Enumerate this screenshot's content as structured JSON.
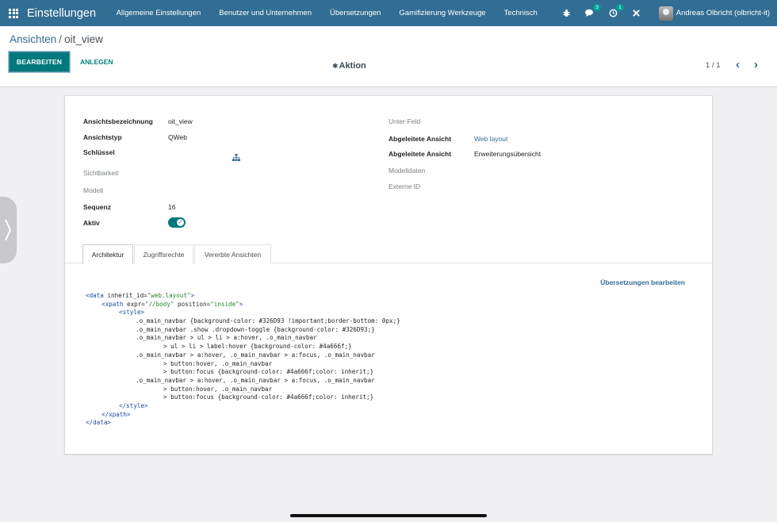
{
  "navbar": {
    "brand": "Einstellungen",
    "menu": [
      "Allgemeine Einstellungen",
      "Benutzer und Unternehmen",
      "Übersetzungen",
      "Gamifizierung Werkzeuge",
      "Technisch"
    ],
    "messages_badge": "3",
    "activity_badge": "1",
    "user_name": "Andreas Olbricht (olbricht-it)",
    "color": "#326D93"
  },
  "breadcrumb": {
    "parent": "Ansichten",
    "separator": "/",
    "current": "oit_view"
  },
  "toolbar": {
    "edit_label": "BEARBEITEN",
    "create_label": "ANLEGEN",
    "action_label": "Aktion"
  },
  "pager": {
    "value": "1 / 1"
  },
  "form": {
    "left": {
      "name_label": "Ansichtsbezeichnung",
      "name_value": "oit_view",
      "type_label": "Ansichtstyp",
      "type_value": "QWeb",
      "key_label": "Schlüssel",
      "visibility_label": "Sichtbarkeit",
      "model_label": "Modell",
      "sequence_label": "Sequenz",
      "sequence_value": "16",
      "active_label": "Aktiv",
      "active_value": true
    },
    "right": {
      "child_field_label": "Unter-Feld",
      "inherited_view_label": "Abgeleitete Ansicht",
      "inherited_view_value": "Web layout",
      "inherit_mode_label": "Abgeleitete Ansicht",
      "inherit_mode_value": "Erweiterungsübersicht",
      "model_data_label": "Modelldaten",
      "external_id_label": "Externe ID"
    }
  },
  "tabs": [
    "Architektur",
    "Zugriffsrechte",
    "Vererbte Ansichten"
  ],
  "translate_label": "Übersetzungen bearbeiten",
  "code": {
    "l1_open": "<data ",
    "l1_attr": "inherit_id=",
    "l1_val": "\"web.layout\"",
    "l1_close": ">",
    "l2_open": "<xpath ",
    "l2_attr1": "expr=",
    "l2_val1": "\"//body\"",
    "l2_attr2": " position=",
    "l2_val2": "\"inside\"",
    "l2_close": ">",
    "l3": "<style>",
    "l4": ".o_main_navbar {background-color: #326D93 !important;border-bottom: 0px;}",
    "l5": ".o_main_navbar .show .dropdown-toggle {background-color: #326D93;}",
    "l6": ".o_main_navbar > ul > li > a:hover, .o_main_navbar",
    "l7": "> ul > li > label:hover {background-color: #4a666f;}",
    "l8": ".o_main_navbar > a:hover, .o_main_navbar > a:focus, .o_main_navbar",
    "l9": "> button:hover, .o_main_navbar",
    "l10": "> button:focus {background-color: #4a666f;color: inherit;}",
    "l11": ".o_main_navbar > a:hover, .o_main_navbar > a:focus, .o_main_navbar",
    "l12": "> button:hover, .o_main_navbar",
    "l13": "> button:focus {background-color: #4a666f;color: inherit;}",
    "l14": "</style>",
    "l15": "</xpath>",
    "l16": "</data>"
  }
}
